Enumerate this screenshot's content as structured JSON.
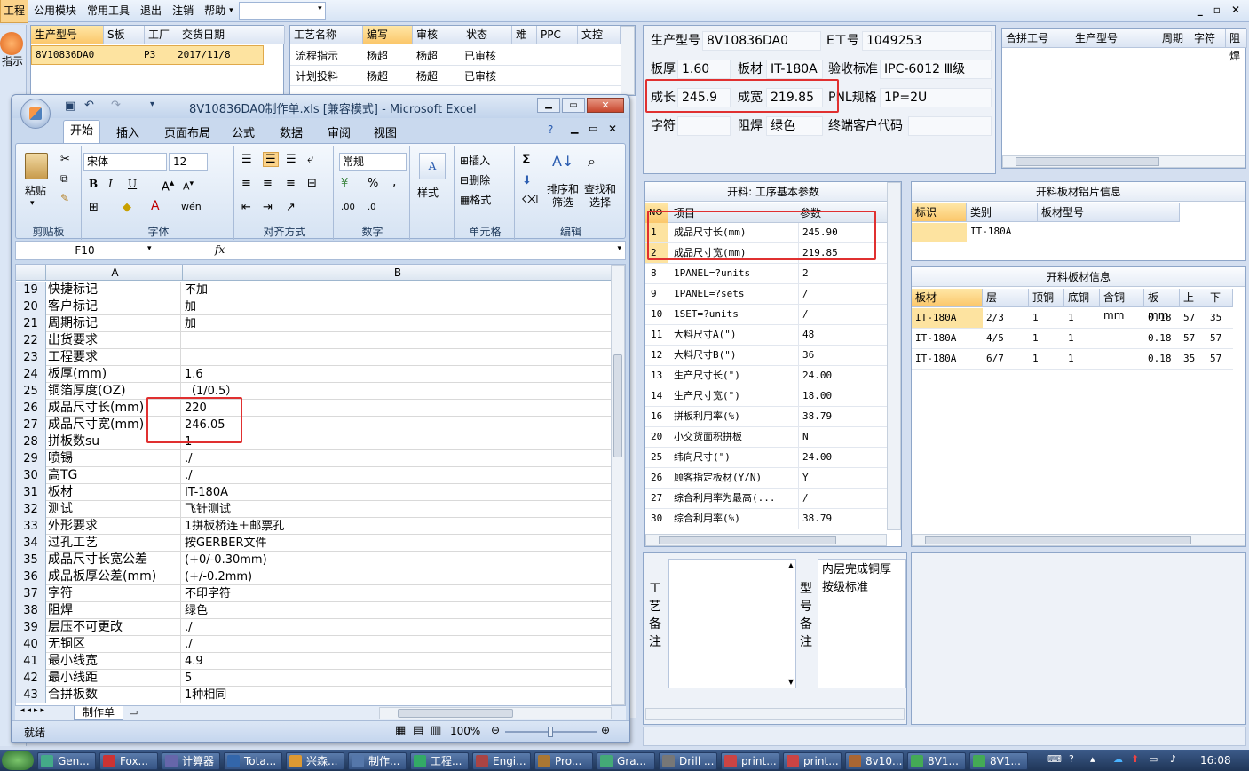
{
  "menu": {
    "items": [
      "工程",
      "公用模块",
      "常用工具",
      "退出",
      "注销",
      "帮助"
    ]
  },
  "left_tool": {
    "label": "指示"
  },
  "order_table": {
    "headers": [
      "生产型号",
      "S板",
      "工厂",
      "交货日期"
    ],
    "row": [
      "8V10836DA0",
      "",
      "P3",
      "2017/11/8"
    ]
  },
  "process_table": {
    "headers": [
      "工艺名称",
      "编写",
      "审核",
      "状态",
      "难",
      "PPC",
      "文控"
    ],
    "rows": [
      [
        "流程指示",
        "杨超",
        "杨超",
        "已审核"
      ],
      [
        "计划投料",
        "杨超",
        "杨超",
        "已审核"
      ]
    ]
  },
  "excel": {
    "title": "8V10836DA0制作单.xls  [兼容模式] - Microsoft Excel",
    "tabs": [
      "开始",
      "插入",
      "页面布局",
      "公式",
      "数据",
      "审阅",
      "视图"
    ],
    "font_name": "宋体",
    "font_size": "12",
    "number_format": "常规",
    "groups": [
      "剪贴板",
      "字体",
      "对齐方式",
      "数字",
      "单元格",
      "编辑"
    ],
    "paste": "粘贴",
    "styles": "样式",
    "cells_btns": [
      "插入",
      "删除",
      "格式"
    ],
    "edit_btns": [
      "排序和\n筛选",
      "查找和\n选择"
    ],
    "name_box": "F10",
    "fx": "fx",
    "col_a": "A",
    "col_b": "B",
    "rows": [
      [
        "19",
        "快捷标记",
        "不加"
      ],
      [
        "20",
        "客户标记",
        "加"
      ],
      [
        "21",
        "周期标记",
        "加"
      ],
      [
        "22",
        "出货要求",
        ""
      ],
      [
        "23",
        "工程要求",
        ""
      ],
      [
        "24",
        "板厚(mm)",
        "1.6"
      ],
      [
        "25",
        "铜箔厚度(OZ)",
        "（1/0.5）"
      ],
      [
        "26",
        "成品尺寸长(mm)",
        "220"
      ],
      [
        "27",
        "成品尺寸宽(mm)",
        "246.05"
      ],
      [
        "28",
        "拼板数su",
        "1"
      ],
      [
        "29",
        "喷锡",
        "./"
      ],
      [
        "30",
        "高TG",
        "./"
      ],
      [
        "31",
        "板材",
        "IT-180A"
      ],
      [
        "32",
        "测试",
        "飞针测试"
      ],
      [
        "33",
        "外形要求",
        "1拼板桥连＋邮票孔"
      ],
      [
        "34",
        "过孔工艺",
        "按GERBER文件"
      ],
      [
        "35",
        "成品尺寸长宽公差",
        "(+0/-0.30mm)"
      ],
      [
        "36",
        "成品板厚公差(mm)",
        "(+/-0.2mm)"
      ],
      [
        "37",
        "字符",
        "不印字符"
      ],
      [
        "38",
        "阻焊",
        "绿色"
      ],
      [
        "39",
        "层压不可更改",
        "./"
      ],
      [
        "40",
        "无铜区",
        "./"
      ],
      [
        "41",
        "最小线宽",
        "4.9"
      ],
      [
        "42",
        "最小线距",
        "5"
      ],
      [
        "43",
        "合拼板数",
        "1种相同"
      ]
    ],
    "sheet_tab": "制作单",
    "status": "就绪",
    "zoom": "100%"
  },
  "product_info": {
    "model_label": "生产型号",
    "model": "8V10836DA0",
    "e_label": "E工号",
    "e_no": "1049253",
    "thick_label": "板厚",
    "thick": "1.60",
    "material_label": "板材",
    "material": "IT-180A",
    "std_label": "验收标准",
    "std": "IPC-6012 Ⅲ级",
    "len_label": "成长",
    "len": "245.9",
    "wid_label": "成宽",
    "wid": "219.85",
    "pnl_label": "PNL规格",
    "pnl": "1P=2U",
    "char_label": "字符",
    "char": "",
    "mask_label": "阻焊",
    "mask": "绿色",
    "cust_label": "终端客户代码",
    "cust": ""
  },
  "merge_table": {
    "headers": [
      "合拼工号",
      "生产型号",
      "周期",
      "字符",
      "阻焊"
    ]
  },
  "params": {
    "title": "开料: 工序基本参数",
    "headers": [
      "NO",
      "项目",
      "参数"
    ],
    "rows": [
      [
        "1",
        "成品尺寸长(mm)",
        "245.90"
      ],
      [
        "2",
        "成品尺寸宽(mm)",
        "219.85"
      ],
      [
        "8",
        "1PANEL=?units",
        "2"
      ],
      [
        "9",
        "1PANEL=?sets",
        "/"
      ],
      [
        "10",
        "1SET=?units",
        "/"
      ],
      [
        "11",
        "大料尺寸A(\")",
        "48"
      ],
      [
        "12",
        "大料尺寸B(\")",
        "36"
      ],
      [
        "13",
        "生产尺寸长(\")",
        "24.00"
      ],
      [
        "14",
        "生产尺寸宽(\")",
        "18.00"
      ],
      [
        "16",
        "拼板利用率(%)",
        "38.79"
      ],
      [
        "20",
        "小交货面积拼板",
        "N"
      ],
      [
        "25",
        "纬向尺寸(\")",
        "24.00"
      ],
      [
        "26",
        "顾客指定板材(Y/N)",
        "Y"
      ],
      [
        "27",
        "综合利用率为最高(...",
        "/"
      ],
      [
        "30",
        "综合利用率(%)",
        "38.79"
      ]
    ]
  },
  "sheet_info": {
    "title": "开料板材铝片信息",
    "headers": [
      "标识",
      "类别",
      "板材型号"
    ],
    "row": [
      "",
      "IT-180A",
      ""
    ]
  },
  "cut_info": {
    "title": "开料板材信息",
    "headers": [
      "板材",
      "层",
      "顶铜",
      "底铜",
      "含铜mm",
      "板mm",
      "上",
      "下"
    ],
    "rows": [
      [
        "IT-180A",
        "2/3",
        "1",
        "1",
        "",
        "0.18",
        "57",
        "35"
      ],
      [
        "IT-180A",
        "4/5",
        "1",
        "1",
        "",
        "0.18",
        "57",
        "57"
      ],
      [
        "IT-180A",
        "6/7",
        "1",
        "1",
        "",
        "0.18",
        "35",
        "57"
      ]
    ]
  },
  "notes": {
    "process_label": "工\n艺\n备\n注",
    "model_label": "型\n号\n备\n注",
    "model_note": "内层完成铜厚按级标准"
  },
  "taskbar": {
    "items": [
      "Gen...",
      "Fox...",
      "计算器",
      "Tota...",
      "兴森...",
      "制作...",
      "工程...",
      "Engi...",
      "Pro...",
      "Gra...",
      "Drill ...",
      "print...",
      "print...",
      "8v10...",
      "8V1...",
      "8V1..."
    ],
    "clock": "16:08"
  },
  "colors": {
    "accent": "#fbc76a",
    "highlight": "#e03030"
  }
}
